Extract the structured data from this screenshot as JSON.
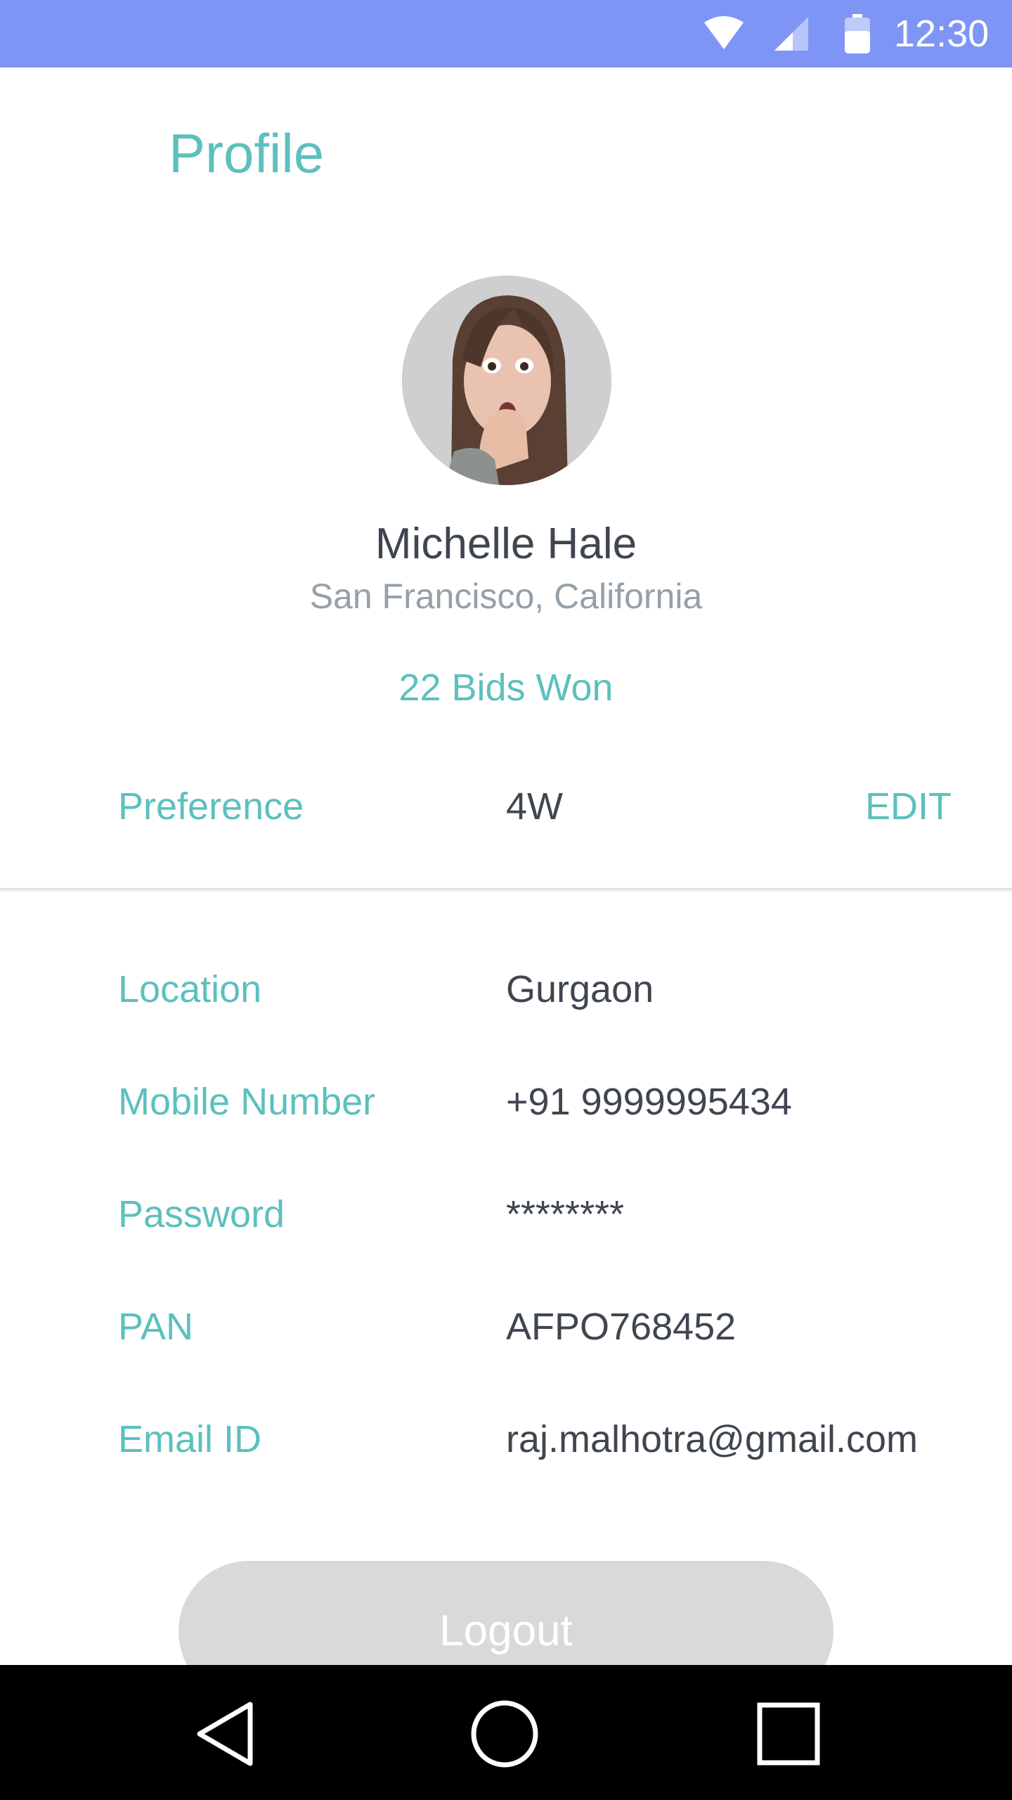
{
  "status_bar": {
    "time": "12:30",
    "background": "#7f95f5",
    "icons": [
      "wifi-icon",
      "signal-icon",
      "battery-icon"
    ]
  },
  "header": {
    "title": "Profile"
  },
  "profile": {
    "name": "Michelle Hale",
    "location": "San Francisco, California",
    "bids_won": "22 Bids Won"
  },
  "preference": {
    "label": "Preference",
    "value": "4W",
    "edit_label": "EDIT"
  },
  "details": [
    {
      "label": "Location",
      "value": "Gurgaon"
    },
    {
      "label": "Mobile Number",
      "value": "+91 9999995434"
    },
    {
      "label": "Password",
      "value": "********"
    },
    {
      "label": "PAN",
      "value": "AFPO768452"
    },
    {
      "label": "Email ID",
      "value": "raj.malhotra@gmail.com"
    }
  ],
  "logout": {
    "label": "Logout"
  },
  "nav_bar": {
    "icons": [
      "back-icon",
      "home-icon",
      "recents-icon"
    ]
  },
  "colors": {
    "accent": "#5cc0be",
    "text_dark": "#3f4650",
    "text_muted": "#96a0a8",
    "button_disabled": "#d9d9d9"
  }
}
